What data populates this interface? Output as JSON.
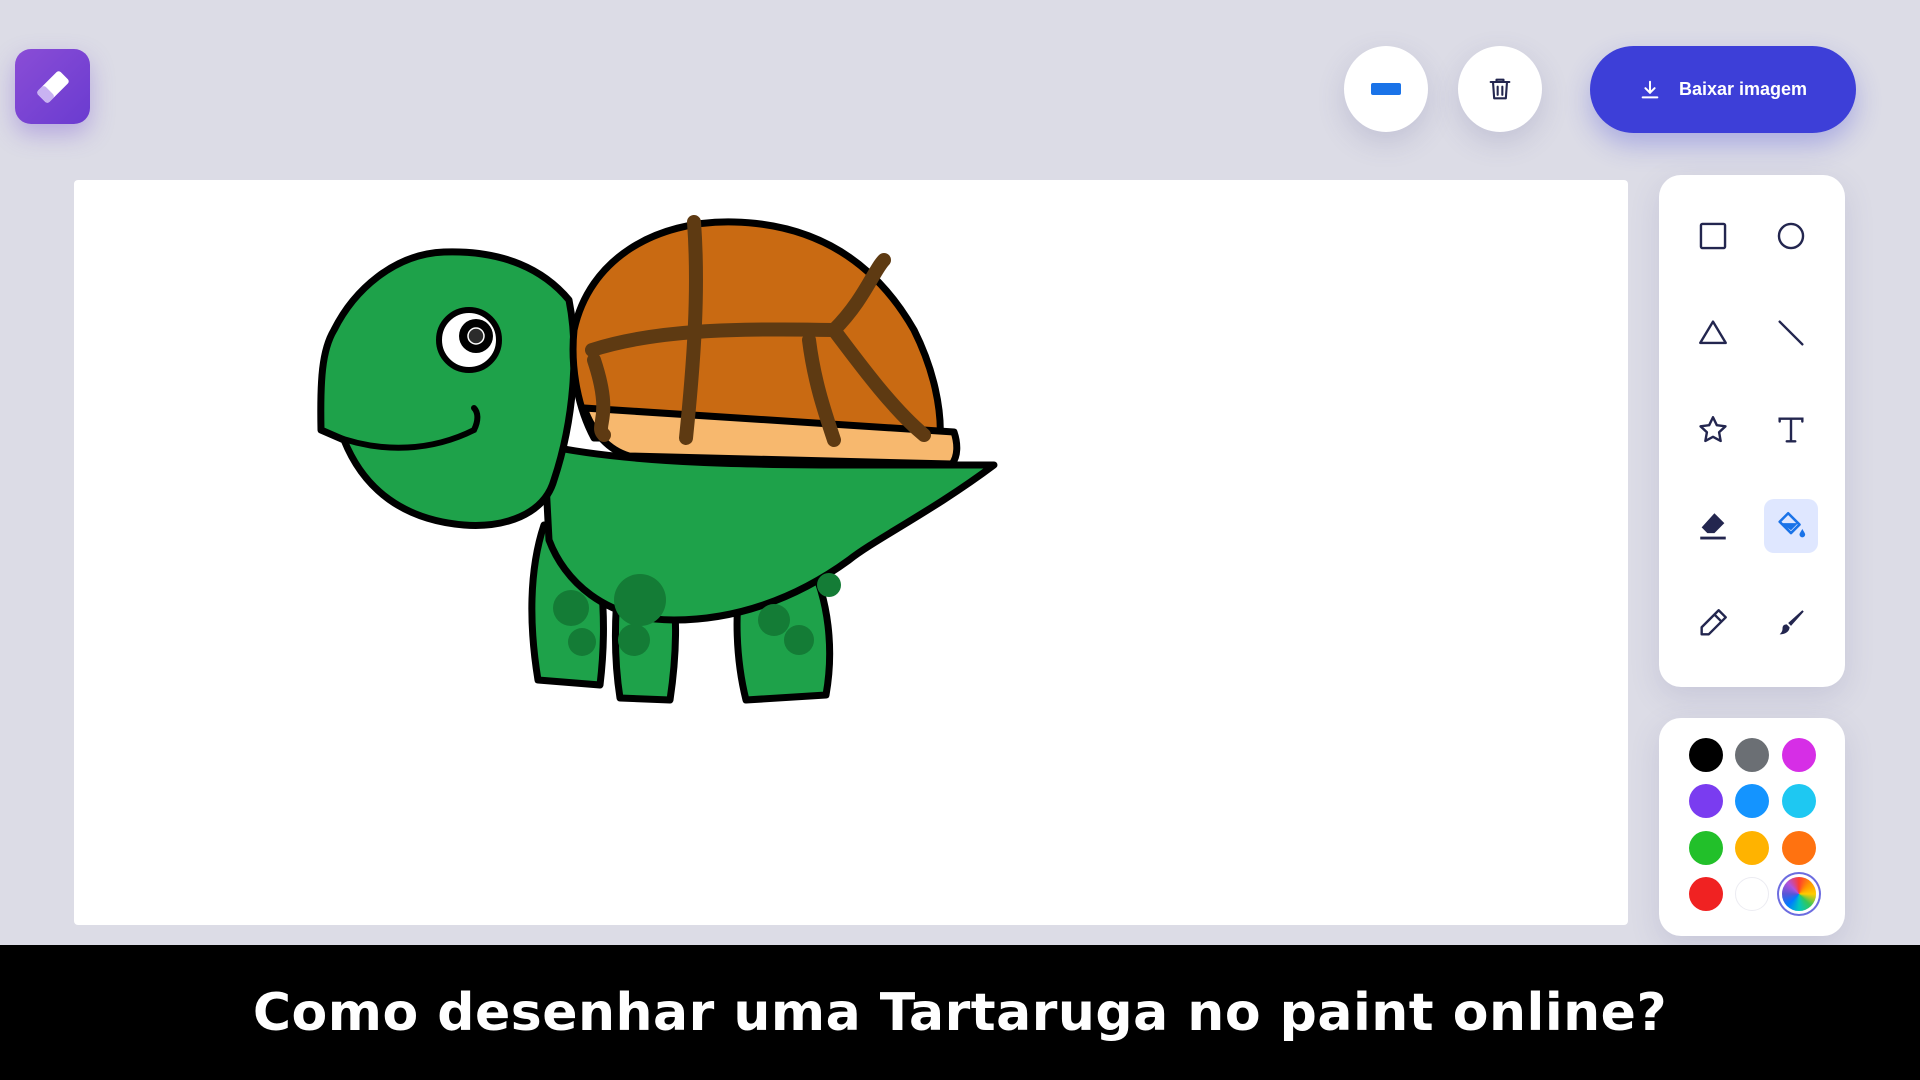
{
  "toolbar": {
    "download_label": "Baixar imagem"
  },
  "tools": [
    {
      "name": "rectangle-tool",
      "icon": "square-icon",
      "active": false
    },
    {
      "name": "circle-tool",
      "icon": "circle-icon",
      "active": false
    },
    {
      "name": "triangle-tool",
      "icon": "triangle-icon",
      "active": false
    },
    {
      "name": "line-tool",
      "icon": "line-icon",
      "active": false
    },
    {
      "name": "star-tool",
      "icon": "star-icon",
      "active": false
    },
    {
      "name": "text-tool",
      "icon": "text-icon",
      "active": false
    },
    {
      "name": "eraser-tool",
      "icon": "eraser-icon",
      "active": false
    },
    {
      "name": "fill-tool",
      "icon": "paint-bucket-icon",
      "active": true
    },
    {
      "name": "pencil-tool",
      "icon": "pencil-icon",
      "active": false
    },
    {
      "name": "brush-tool",
      "icon": "brush-icon",
      "active": false
    }
  ],
  "palette": [
    "#000000",
    "#6b6f74",
    "#d62ee6",
    "#7a3cf0",
    "#1494ff",
    "#1ec8f2",
    "#22c02a",
    "#ffb300",
    "#ff7210",
    "#f02222",
    "#ffffff",
    "rainbow"
  ],
  "colors": {
    "accent": "#3d3fd8",
    "active_tool_bg": "#dfe7ff",
    "icon": "#23264f",
    "turtle_body": "#1ea24a",
    "turtle_shell": "#c96a12",
    "shell_lines": "#5e3a12",
    "shell_rim": "#f7b86e"
  },
  "caption": {
    "text": "Como desenhar uma Tartaruga no paint online?"
  }
}
